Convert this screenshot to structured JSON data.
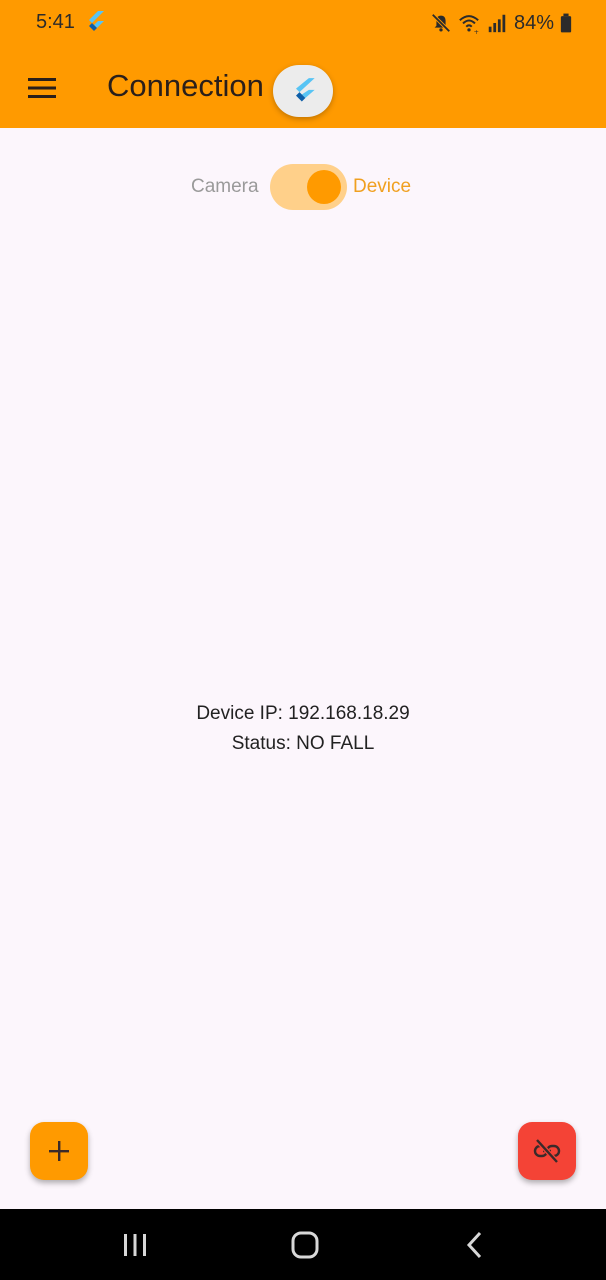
{
  "status_bar": {
    "time": "5:41",
    "battery_percent": "84%",
    "icons": [
      "flutter-icon",
      "mute-icon",
      "wifi-icon",
      "signal-icon",
      "battery-icon"
    ]
  },
  "app_bar": {
    "title": "Connection",
    "menu_icon": "menu-icon",
    "background": "#ff9a00"
  },
  "mode_toggle": {
    "left_label": "Camera",
    "right_label": "Device",
    "selected": "Device"
  },
  "device": {
    "ip_text": "Device IP: 192.168.18.29",
    "status_text": "Status: NO FALL"
  },
  "fabs": {
    "add_icon": "plus-icon",
    "disconnect_icon": "link-off-icon",
    "add_color": "#ff9a00",
    "disconnect_color": "#f44336"
  },
  "nav_bar": {
    "buttons": [
      "recents-icon",
      "home-icon",
      "back-icon"
    ]
  }
}
